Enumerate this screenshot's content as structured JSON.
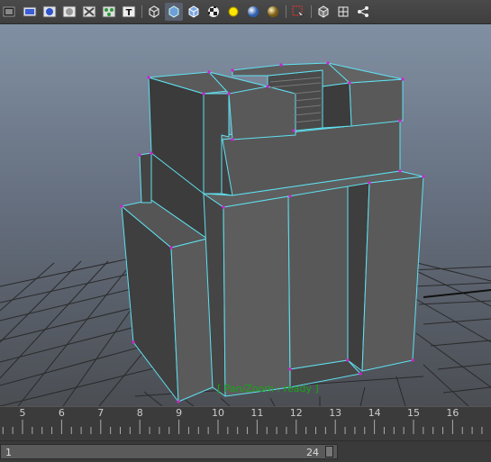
{
  "toolbar": {
    "icons": [
      "display-mode-icon",
      "film-gate-icon",
      "sphere-shaded-icon",
      "isolate-icon",
      "xray-icon",
      "joint-icon",
      "text-icon",
      "wireframe-cube-icon",
      "smooth-shade-cube-icon",
      "shaded-wireframe-cube-icon",
      "checker-texture-icon",
      "default-light-icon",
      "shaded-sphere-icon",
      "gold-sphere-icon",
      "selection-highlight-icon",
      "camera-cube-icon",
      "grid-cube-icon",
      "node-graph-icon"
    ]
  },
  "viewport": {
    "hud_message": "[ Pan/Zoom : ready ]",
    "background_top": "#7f8ea0",
    "background_bottom": "#4a4d52",
    "grid_color": "#2b2b2b",
    "wire_color": "#5fe0f0",
    "vertex_color": "#d020d0"
  },
  "timeline": {
    "ticks": [
      "5",
      "6",
      "7",
      "8",
      "9",
      "10",
      "11",
      "12",
      "13",
      "14",
      "15",
      "16"
    ]
  },
  "range": {
    "start": "1",
    "end": "24"
  }
}
